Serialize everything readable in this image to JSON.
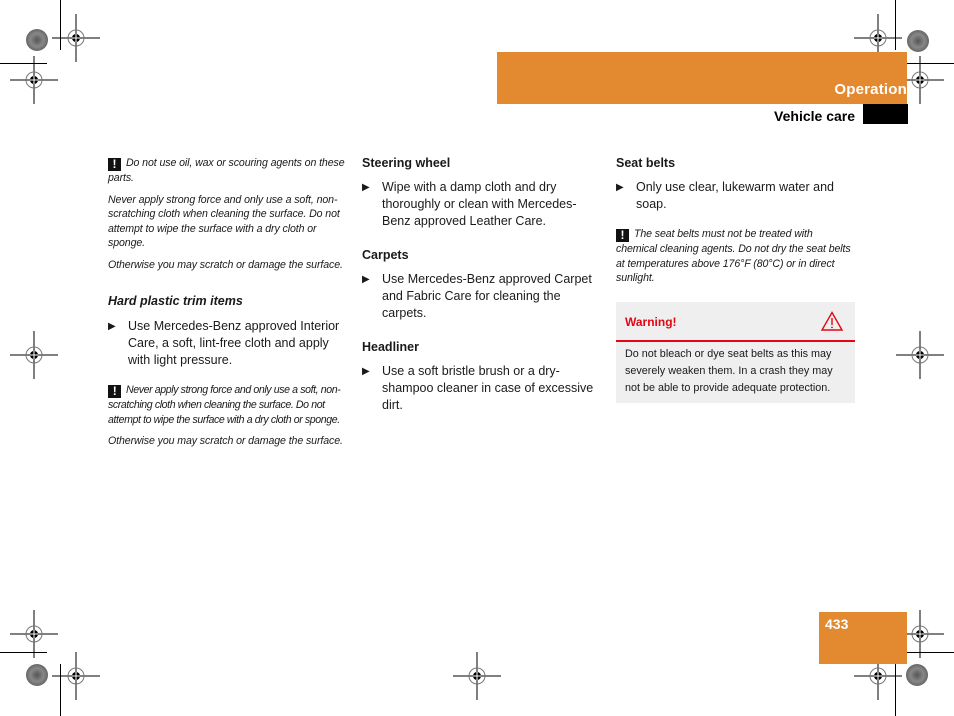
{
  "header": {
    "section_title": "Operation",
    "subsection_title": "Vehicle care",
    "accent_color": "#e38a30"
  },
  "page_number": "433",
  "column1": {
    "note1": {
      "icon": "exclamation-icon",
      "paragraphs": [
        "Do not use oil, wax or scouring agents on these parts.",
        "Never apply strong force and only use a soft, non-scratching cloth when cleaning the surface. Do not attempt to wipe the surface with a dry cloth or sponge.",
        "Otherwise you may scratch or damage the surface."
      ]
    },
    "section": {
      "heading": "Hard plastic trim items",
      "bullet": "Use Mercedes-Benz approved Interior Care, a soft, lint-free cloth and apply with light pressure."
    },
    "note2": {
      "icon": "exclamation-icon",
      "paragraphs": [
        "Never apply strong force and only use a soft, non-scratching cloth when cleaning the surface. Do not attempt to wipe the surface with a dry cloth or sponge.",
        "Otherwise you may scratch or damage the surface."
      ]
    }
  },
  "column2": {
    "sections": [
      {
        "heading": "Steering wheel",
        "bullet": "Wipe with a damp cloth and dry thoroughly or clean with Mercedes-Benz approved Leather Care."
      },
      {
        "heading": "Carpets",
        "bullet": "Use Mercedes-Benz approved Carpet and Fabric Care for cleaning the carpets."
      },
      {
        "heading": "Headliner",
        "bullet": "Use a soft bristle brush or a dry-shampoo cleaner in case of excessive dirt."
      }
    ]
  },
  "column3": {
    "section": {
      "heading": "Seat belts",
      "bullet": "Only use clear, lukewarm water and soap."
    },
    "note": {
      "icon": "exclamation-icon",
      "text": "The seat belts must not be treated with chemical cleaning agents. Do not dry the seat belts at temperatures above 176°F (80°C) or in direct sunlight."
    },
    "warning": {
      "title": "Warning!",
      "icon": "warning-triangle-icon",
      "text": "Do not bleach or dye seat belts as this may severely weaken them. In a crash they may not be able to provide adequate protection.",
      "color": "#e30613"
    }
  },
  "bullet_glyph": "▶",
  "exclamation_glyph": "!"
}
